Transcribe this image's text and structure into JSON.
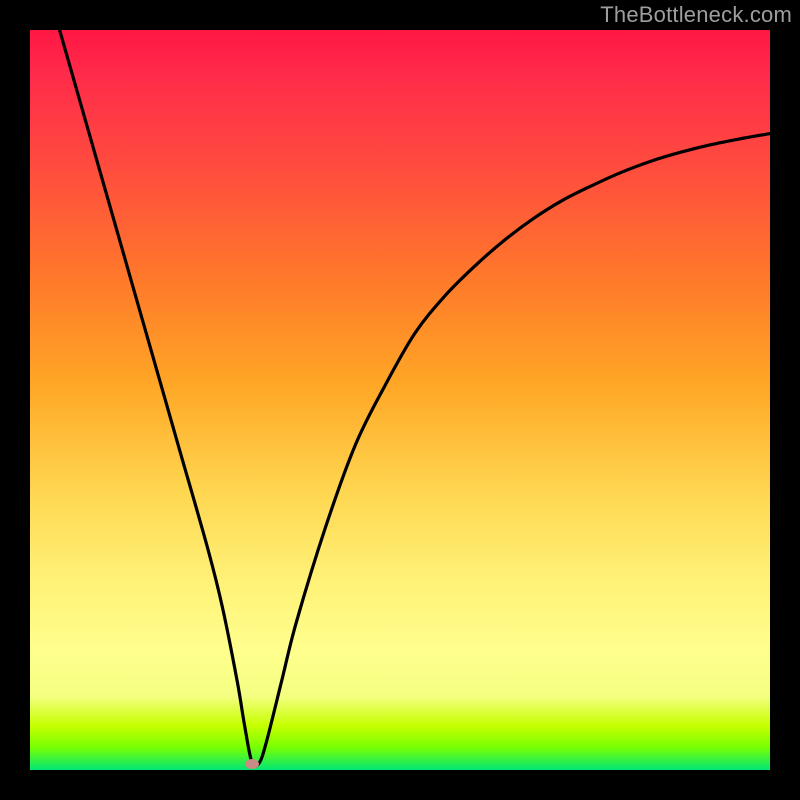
{
  "watermark": "TheBottleneck.com",
  "chart_data": {
    "type": "line",
    "title": "",
    "xlabel": "",
    "ylabel": "",
    "xlim": [
      0,
      100
    ],
    "ylim": [
      0,
      100
    ],
    "grid": false,
    "legend": false,
    "series": [
      {
        "name": "bottleneck-curve",
        "x": [
          4,
          8,
          12,
          16,
          20,
          24,
          26,
          28,
          29,
          30,
          31,
          32,
          34,
          36,
          40,
          44,
          48,
          52,
          56,
          60,
          64,
          68,
          72,
          76,
          80,
          84,
          88,
          92,
          96,
          100
        ],
        "y": [
          100,
          86,
          72,
          58,
          44,
          30,
          22,
          12,
          6,
          1,
          1,
          4,
          12,
          20,
          33,
          44,
          52,
          59,
          64,
          68,
          71.5,
          74.5,
          77,
          79,
          80.8,
          82.3,
          83.5,
          84.5,
          85.3,
          86
        ]
      }
    ],
    "marker": {
      "x": 30,
      "y": 0.8,
      "color": "#c98b82"
    },
    "gradient_stops": [
      {
        "pos": 0,
        "color": "#ff1744"
      },
      {
        "pos": 34,
        "color": "#ff7a2a"
      },
      {
        "pos": 62,
        "color": "#ffd54f"
      },
      {
        "pos": 84,
        "color": "#ffff8d"
      },
      {
        "pos": 100,
        "color": "#00e676"
      }
    ]
  }
}
